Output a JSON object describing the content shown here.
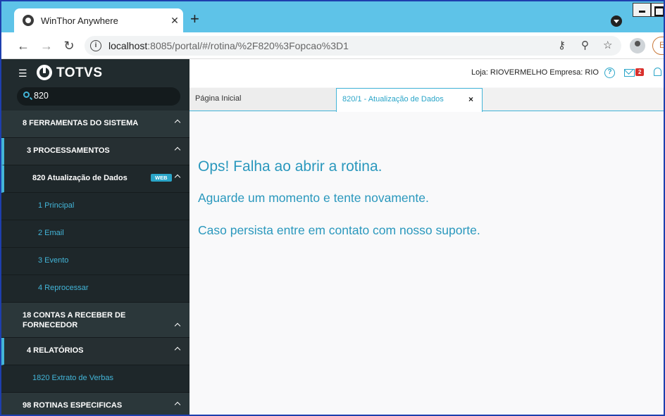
{
  "browser": {
    "tab_title": "WinThor Anywhere",
    "tab_close": "✕",
    "new_tab": "+",
    "url_host": "localhost",
    "url_path": ":8085/portal/#/rotina/%2F820%3Fopcao%3D1",
    "profile_initial": "Er"
  },
  "sidebar": {
    "logo": "TOTVS",
    "search_value": "820",
    "items": [
      {
        "label": "8  FERRAMENTAS DO SISTEMA"
      },
      {
        "label": "3  PROCESSAMENTOS"
      },
      {
        "label": "820  Atualização de Dados",
        "badge": "WEB"
      },
      {
        "label": "1  Principal"
      },
      {
        "label": "2  Email"
      },
      {
        "label": "3  Evento"
      },
      {
        "label": "4  Reprocessar"
      },
      {
        "label": "18  CONTAS A RECEBER DE FORNECEDOR"
      },
      {
        "label": "4  RELATÓRIOS"
      },
      {
        "label": "1820  Extrato de Verbas"
      },
      {
        "label": "98  ROTINAS ESPECIFICAS"
      }
    ]
  },
  "header": {
    "loja": "Loja: RIOVERMELHO  Empresa: RIO",
    "mail_count": "2",
    "help": "?"
  },
  "tabs": {
    "home": "Página Inicial",
    "active": "820/1 - Atualização de Dados",
    "close": "×"
  },
  "error": {
    "title": "Ops! Falha ao abrir a rotina.",
    "line1": "Aguarde um momento e tente novamente.",
    "line2": "Caso persista entre em contato com nosso suporte."
  },
  "colors": {
    "accent": "#2aa5c8",
    "sidebar_bg": "#212b2e",
    "browser_bar": "#5ec3e8"
  }
}
